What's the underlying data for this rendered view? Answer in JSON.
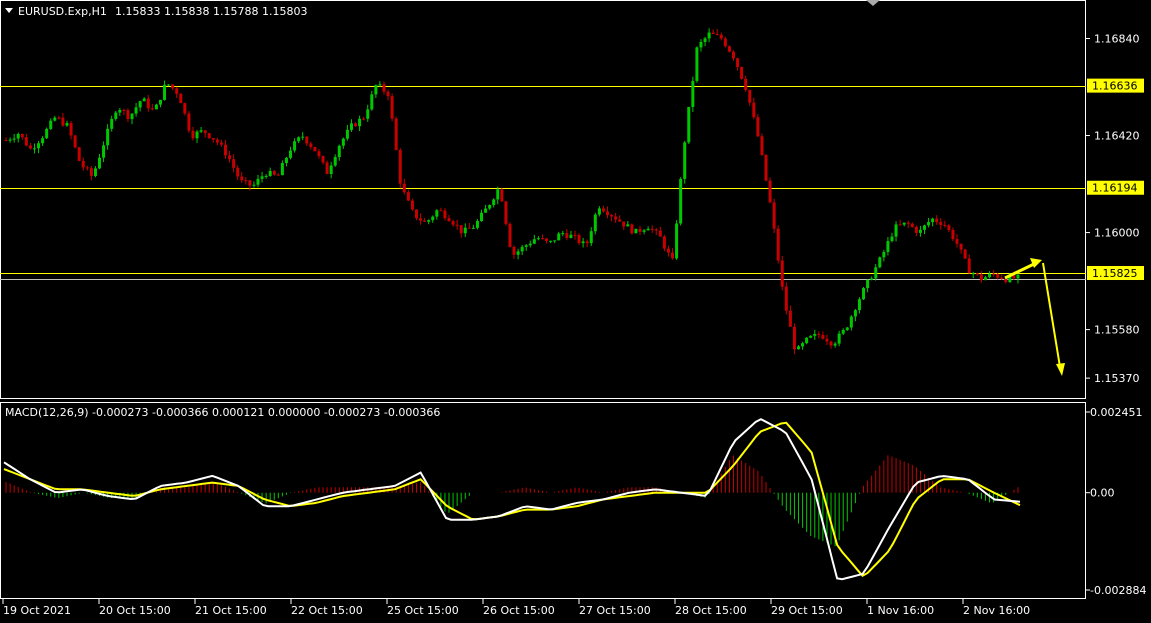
{
  "header": {
    "symbol": "EURUSD.Exp,H1",
    "ohlc": "1.15833 1.15838 1.15788 1.15803"
  },
  "macd_header": "MACD(12,26,9) -0.000273 -0.000366 0.000121 0.000000 -0.000273 -0.000366",
  "colors": {
    "background": "#000000",
    "bull": "#00c800",
    "bear": "#c80000",
    "level": "#ffff00",
    "macd_line": "#ffffff",
    "signal_line": "#ffff00",
    "grid": "#ffffff"
  },
  "chart_data": [
    {
      "type": "candlestick",
      "title": "",
      "ylim": [
        1.1531,
        1.1692
      ],
      "price_ticks": [
        "1.16840",
        "1.16420",
        "1.16000",
        "1.15580",
        "1.15370"
      ],
      "levels": [
        {
          "value": 1.16636,
          "label": "1.16636"
        },
        {
          "value": 1.16194,
          "label": "1.16194"
        },
        {
          "value": 1.15825,
          "label": "1.15825"
        }
      ],
      "time_labels": [
        "19 Oct 2021",
        "20 Oct 15:00",
        "21 Oct 15:00",
        "22 Oct 15:00",
        "25 Oct 15:00",
        "26 Oct 15:00",
        "27 Oct 15:00",
        "28 Oct 15:00",
        "29 Oct 15:00",
        "1 Nov 16:00",
        "2 Nov 16:00"
      ],
      "close_path": [
        1.164,
        1.1643,
        1.1636,
        1.1642,
        1.165,
        1.1646,
        1.163,
        1.1624,
        1.164,
        1.1655,
        1.165,
        1.1658,
        1.1652,
        1.1665,
        1.166,
        1.1642,
        1.1644,
        1.164,
        1.1633,
        1.1622,
        1.162,
        1.1626,
        1.1624,
        1.1636,
        1.1642,
        1.1636,
        1.1626,
        1.1638,
        1.1646,
        1.165,
        1.1664,
        1.166,
        1.162,
        1.1608,
        1.1604,
        1.161,
        1.1606,
        1.16,
        1.1603,
        1.1611,
        1.162,
        1.159,
        1.1594,
        1.1598,
        1.1595,
        1.16,
        1.1598,
        1.1594,
        1.1612,
        1.1608,
        1.1604,
        1.16,
        1.1603,
        1.1598,
        1.1587,
        1.164,
        1.168,
        1.1686,
        1.1684,
        1.1676,
        1.1662,
        1.164,
        1.161,
        1.1572,
        1.1548,
        1.1554,
        1.1556,
        1.1552,
        1.1558,
        1.157,
        1.158,
        1.159,
        1.1602,
        1.1604,
        1.16,
        1.1606,
        1.1604,
        1.1596,
        1.1584,
        1.158,
        1.1582,
        1.158,
        1.15803
      ]
    },
    {
      "type": "line",
      "title": "",
      "ylim": [
        -0.002884,
        0.002451
      ],
      "y_ticks": [
        "0.002451",
        "0.00",
        "-0.002884"
      ],
      "macd_path": [
        0.0009,
        0.0004,
        0.0,
        0.0001,
        -0.0001,
        -0.0002,
        0.0002,
        0.0003,
        0.0005,
        0.0002,
        -0.0004,
        -0.0004,
        -0.0002,
        0.0,
        0.0001,
        0.0002,
        0.0006,
        -0.0008,
        -0.0008,
        -0.0007,
        -0.0004,
        -0.0005,
        -0.0003,
        -0.0002,
        0.0,
        0.0001,
        0.0,
        -0.0001,
        0.0015,
        0.0022,
        0.0018,
        0.0004,
        -0.0026,
        -0.0024,
        -0.001,
        0.0003,
        0.0005,
        0.0004,
        -0.0002,
        -0.00027
      ],
      "signal_path": [
        0.0007,
        0.0004,
        0.0001,
        0.0001,
        0.0,
        -0.0001,
        0.0001,
        0.0002,
        0.0003,
        0.0002,
        -0.0002,
        -0.0004,
        -0.0003,
        -0.0001,
        0.0,
        0.0001,
        0.0004,
        -0.0004,
        -0.0008,
        -0.0007,
        -0.0005,
        -0.0005,
        -0.0004,
        -0.0002,
        -0.0001,
        0.0,
        0.0,
        0.0,
        0.0008,
        0.0018,
        0.0021,
        0.0012,
        -0.0016,
        -0.0025,
        -0.0017,
        -0.0002,
        0.0004,
        0.0004,
        0.0,
        -0.00037
      ]
    }
  ]
}
